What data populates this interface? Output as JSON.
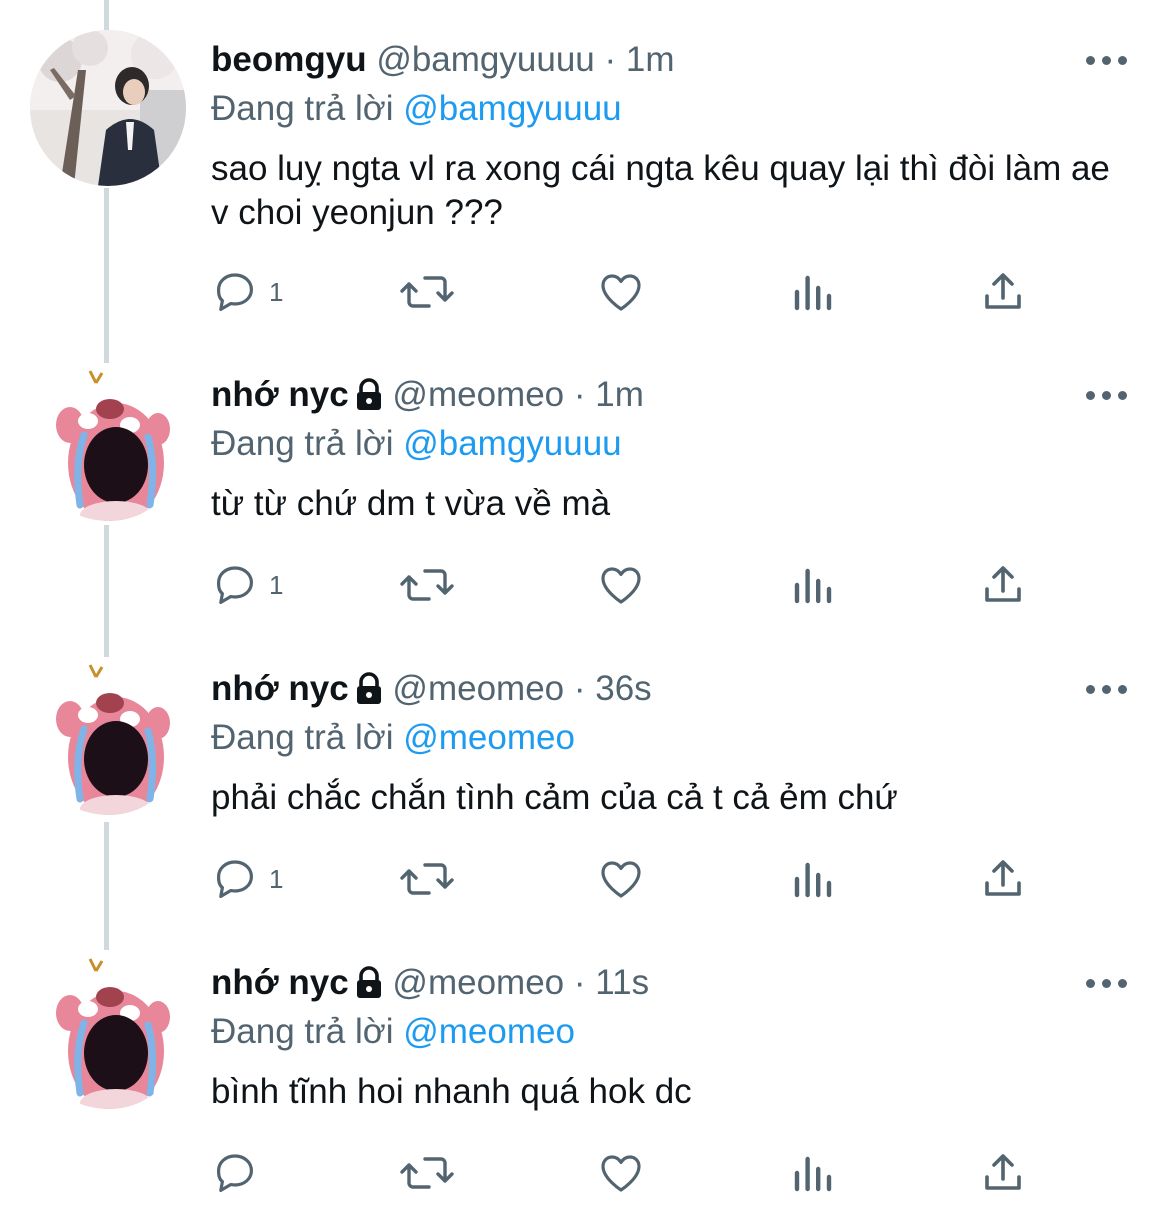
{
  "tweets": [
    {
      "name": "beomgyu",
      "handle": "@bamgyuuuu",
      "dot": "·",
      "time": "1m",
      "replying_prefix": "Đang trả lời",
      "replying_to": "@bamgyuuuu",
      "text": "sao luỵ ngta vl ra xong cái ngta kêu quay lại thì đòi làm ae v choi yeonjun ???",
      "reply_count": "1",
      "protected": false,
      "avatar": "photo-person"
    },
    {
      "name": "nhớ nyc",
      "handle": "@meomeo",
      "dot": "·",
      "time": "1m",
      "replying_prefix": "Đang trả lời",
      "replying_to": "@bamgyuuuu",
      "text": "từ từ chứ dm t vừa về mà",
      "reply_count": "1",
      "protected": true,
      "avatar": "pink-crying-beaver"
    },
    {
      "name": "nhớ nyc",
      "handle": "@meomeo",
      "dot": "·",
      "time": "36s",
      "replying_prefix": "Đang trả lời",
      "replying_to": "@meomeo",
      "text": "phải chắc chắn tình cảm của cả t cả ẻm chứ",
      "reply_count": "1",
      "protected": true,
      "avatar": "pink-crying-beaver"
    },
    {
      "name": "nhớ nyc",
      "handle": "@meomeo",
      "dot": "·",
      "time": "11s",
      "replying_prefix": "Đang trả lời",
      "replying_to": "@meomeo",
      "text": "bình tĩnh hoi nhanh quá hok dc",
      "reply_count": "",
      "protected": true,
      "avatar": "pink-crying-beaver"
    }
  ],
  "icons": {
    "reply": "reply-icon",
    "retweet": "retweet-icon",
    "like": "like-icon",
    "views": "views-icon",
    "share": "share-icon",
    "more": "more-icon",
    "lock": "lock-icon"
  },
  "colors": {
    "text": "#0f1419",
    "secondary": "#536471",
    "link": "#1d9bf0",
    "thread_line": "#cfd9de"
  }
}
